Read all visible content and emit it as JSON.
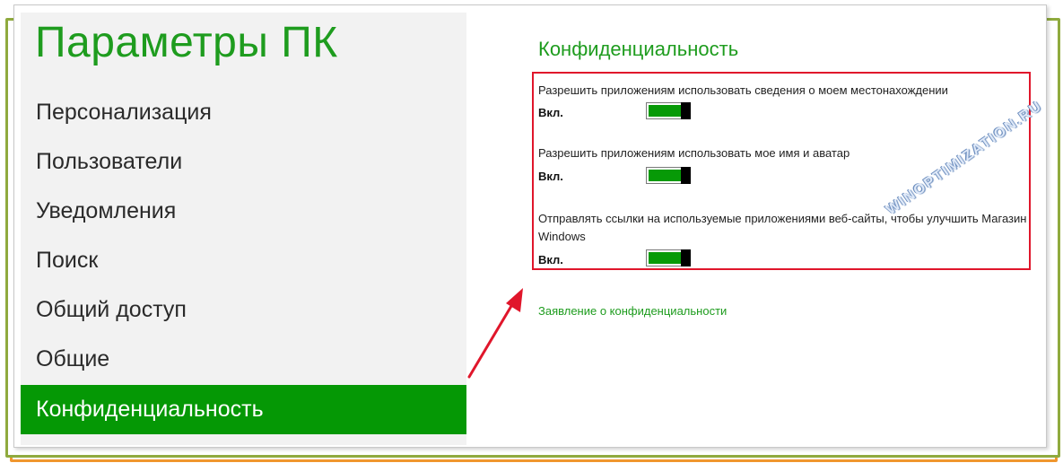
{
  "sidebar": {
    "title": "Параметры ПК",
    "items": [
      {
        "label": "Персонализация"
      },
      {
        "label": "Пользователи"
      },
      {
        "label": "Уведомления"
      },
      {
        "label": "Поиск"
      },
      {
        "label": "Общий доступ"
      },
      {
        "label": "Общие"
      },
      {
        "label": "Конфиденциальность",
        "selected": true
      }
    ]
  },
  "main": {
    "section_title": "Конфиденциальность",
    "settings": [
      {
        "label": "Разрешить приложениям использовать сведения о моем местонахождении",
        "state": "Вкл."
      },
      {
        "label": "Разрешить приложениям использовать мое имя и аватар",
        "state": "Вкл."
      },
      {
        "label": "Отправлять ссылки на используемые приложениями веб-сайты, чтобы улучшить Магазин Windows",
        "state": "Вкл."
      }
    ],
    "privacy_link": "Заявление о конфиденциальности"
  },
  "watermark": "WINOPTIMIZATION.RU",
  "colors": {
    "accent": "#1e9c1e",
    "selected_bg": "#059805",
    "highlight_box": "#e0162b",
    "arrow": "#e0162b"
  }
}
